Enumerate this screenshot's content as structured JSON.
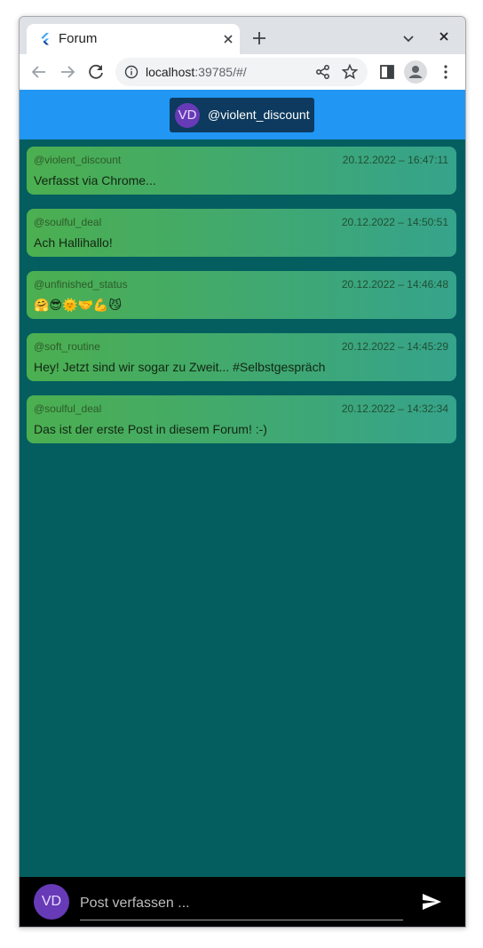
{
  "browser": {
    "tab_title": "Forum",
    "url_host": "localhost",
    "url_path": ":39785/#/"
  },
  "header": {
    "avatar_initials": "VD",
    "username": "@violent_discount",
    "color": "#2196f3"
  },
  "posts": [
    {
      "author": "@violent_discount",
      "date": "20.12.2022 – 16:47:11",
      "text": "Verfasst via Chrome..."
    },
    {
      "author": "@soulful_deal",
      "date": "20.12.2022 – 14:50:51",
      "text": "Ach Hallihallo!"
    },
    {
      "author": "@unfinished_status",
      "date": "20.12.2022 – 14:46:48",
      "text": "🤗😎🌞🤝💪😼"
    },
    {
      "author": "@soft_routine",
      "date": "20.12.2022 – 14:45:29",
      "text": "Hey! Jetzt sind wir sogar zu Zweit... #Selbstgespräch"
    },
    {
      "author": "@soulful_deal",
      "date": "20.12.2022 – 14:32:34",
      "text": "Das ist der erste Post in diesem Forum! :-)"
    }
  ],
  "composer": {
    "avatar_initials": "VD",
    "placeholder": "Post verfassen ..."
  },
  "colors": {
    "app_background": "#045e5f",
    "post_gradient_start": "#4caf50",
    "post_gradient_end": "#36a38c",
    "avatar": "#673ab7"
  }
}
